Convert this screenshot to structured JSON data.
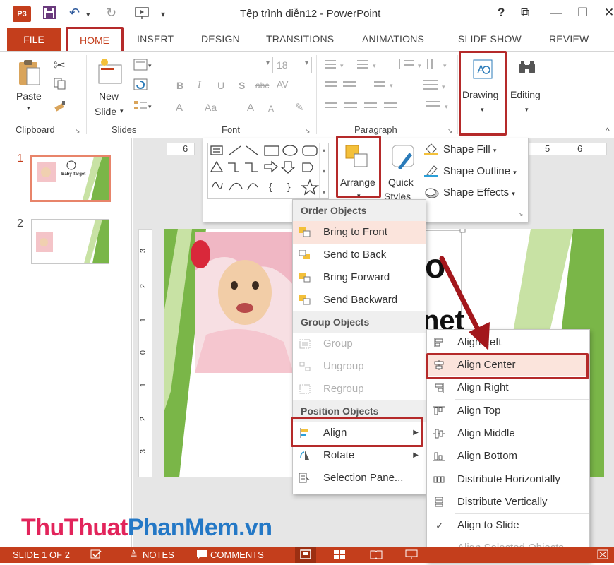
{
  "window": {
    "title": "Tệp trình diễn12 - PowerPoint",
    "app_logo": "P3",
    "help": "?",
    "restore": "⧉",
    "minimize": "—",
    "maximize": "☐",
    "close": "✕"
  },
  "tabs": [
    "FILE",
    "HOME",
    "INSERT",
    "DESIGN",
    "TRANSITIONS",
    "ANIMATIONS",
    "SLIDE SHOW",
    "REVIEW"
  ],
  "ribbon": {
    "clipboard": {
      "paste": "Paste",
      "label": "Clipboard"
    },
    "slides": {
      "new_slide_1": "New",
      "new_slide_2": "Slide",
      "label": "Slides"
    },
    "font": {
      "size": "18",
      "bold": "B",
      "italic": "I",
      "underline": "U",
      "shadow": "S",
      "strike": "abc",
      "spacing": "AV",
      "font_color": "A",
      "case": "Aa",
      "grow": "A",
      "shrink": "A",
      "label": "Font"
    },
    "paragraph": {
      "label": "Paragraph"
    },
    "drawing": {
      "label": "Drawing"
    },
    "editing": {
      "label": "Editing"
    }
  },
  "ruler": {
    "left_num": "6",
    "right_num_1": "5",
    "right_num_2": "6"
  },
  "vruler": [
    "3",
    "2",
    "1",
    "0",
    "1",
    "2",
    "3"
  ],
  "drawing_panel": {
    "arrange": "Arrange",
    "quick_styles_1": "Quick",
    "quick_styles_2": "Styles",
    "shape_fill": "Shape Fill",
    "shape_outline": "Shape Outline",
    "shape_effects": "Shape Effects"
  },
  "thumbnails": [
    {
      "num": "1",
      "caption": "Baby Target"
    },
    {
      "num": "2"
    }
  ],
  "slide": {
    "text_fragment_1": "o",
    "text_fragment_2": "net"
  },
  "arrange_menu": {
    "order_header": "Order Objects",
    "order_items": [
      "Bring to Front",
      "Send to Back",
      "Bring Forward",
      "Send Backward"
    ],
    "group_header": "Group Objects",
    "group_items": [
      "Group",
      "Ungroup",
      "Regroup"
    ],
    "position_header": "Position Objects",
    "align": "Align",
    "rotate": "Rotate",
    "selection_pane": "Selection Pane..."
  },
  "align_menu": {
    "items": [
      "Align Left",
      "Align Center",
      "Align Right",
      "Align Top",
      "Align Middle",
      "Align Bottom",
      "Distribute Horizontally",
      "Distribute Vertically",
      "Align to Slide",
      "Align Selected Objects"
    ],
    "checked": "✓"
  },
  "status": {
    "slide": "SLIDE 1 OF 2",
    "notes": "NOTES",
    "comments": "COMMENTS"
  },
  "watermark": {
    "part1": "ThuThuat",
    "part2": "PhanMem",
    "part3": ".vn"
  },
  "colors": {
    "accent": "#c43e1c",
    "highlight_box": "#b52a2a",
    "slide_green": "#7ab648",
    "menu_highlight": "#fbe4dc"
  }
}
